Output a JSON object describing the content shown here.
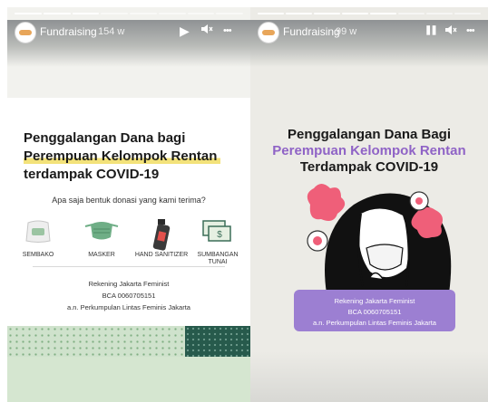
{
  "stories": [
    {
      "account": "Fundraising",
      "age": "154 w",
      "paused": false,
      "progress": {
        "segments": 8,
        "completed": 3
      },
      "card": {
        "title_line1": "Penggalangan Dana bagi",
        "title_line2": "Perempuan Kelompok Rentan",
        "title_line3": "terdampak COVID-19",
        "question": "Apa saja bentuk donasi yang kami terima?",
        "items": [
          {
            "icon": "rice-bag-icon",
            "label": "SEMBAKO"
          },
          {
            "icon": "face-mask-icon",
            "label": "MASKER"
          },
          {
            "icon": "hand-sanitizer-icon",
            "label": "HAND SANITIZER"
          },
          {
            "icon": "cash-icon",
            "label": "SUMBANGAN TUNAI"
          }
        ],
        "account_name": "Rekening Jakarta Feminist",
        "account_number": "BCA 0060705151",
        "account_holder": "a.n. Perkumpulan Lintas Feminis Jakarta"
      }
    },
    {
      "account": "Fundraising",
      "age": "99 w",
      "paused": true,
      "progress": {
        "segments": 8,
        "completed": 5
      },
      "card": {
        "title_line1": "Penggalangan Dana Bagi",
        "title_line2": "Perempuan Kelompok Rentan",
        "title_line3": "Terdampak COVID-19",
        "account_name": "Rekening Jakarta Feminist",
        "account_number": "BCA 0060705151",
        "account_holder": "a.n. Perkumpulan Lintas Feminis Jakarta"
      }
    }
  ],
  "icons": {
    "play": "▶",
    "pause": "❚❚",
    "volume": "◀",
    "more": "•••"
  },
  "colors": {
    "highlight": "#f3e27a",
    "purple_accent": "#8f63c6",
    "account_box": "#9c7fd2",
    "footer_green_dark": "#275a4c",
    "footer_green_light": "#cfe2cc",
    "mask_green": "#6fae86"
  }
}
